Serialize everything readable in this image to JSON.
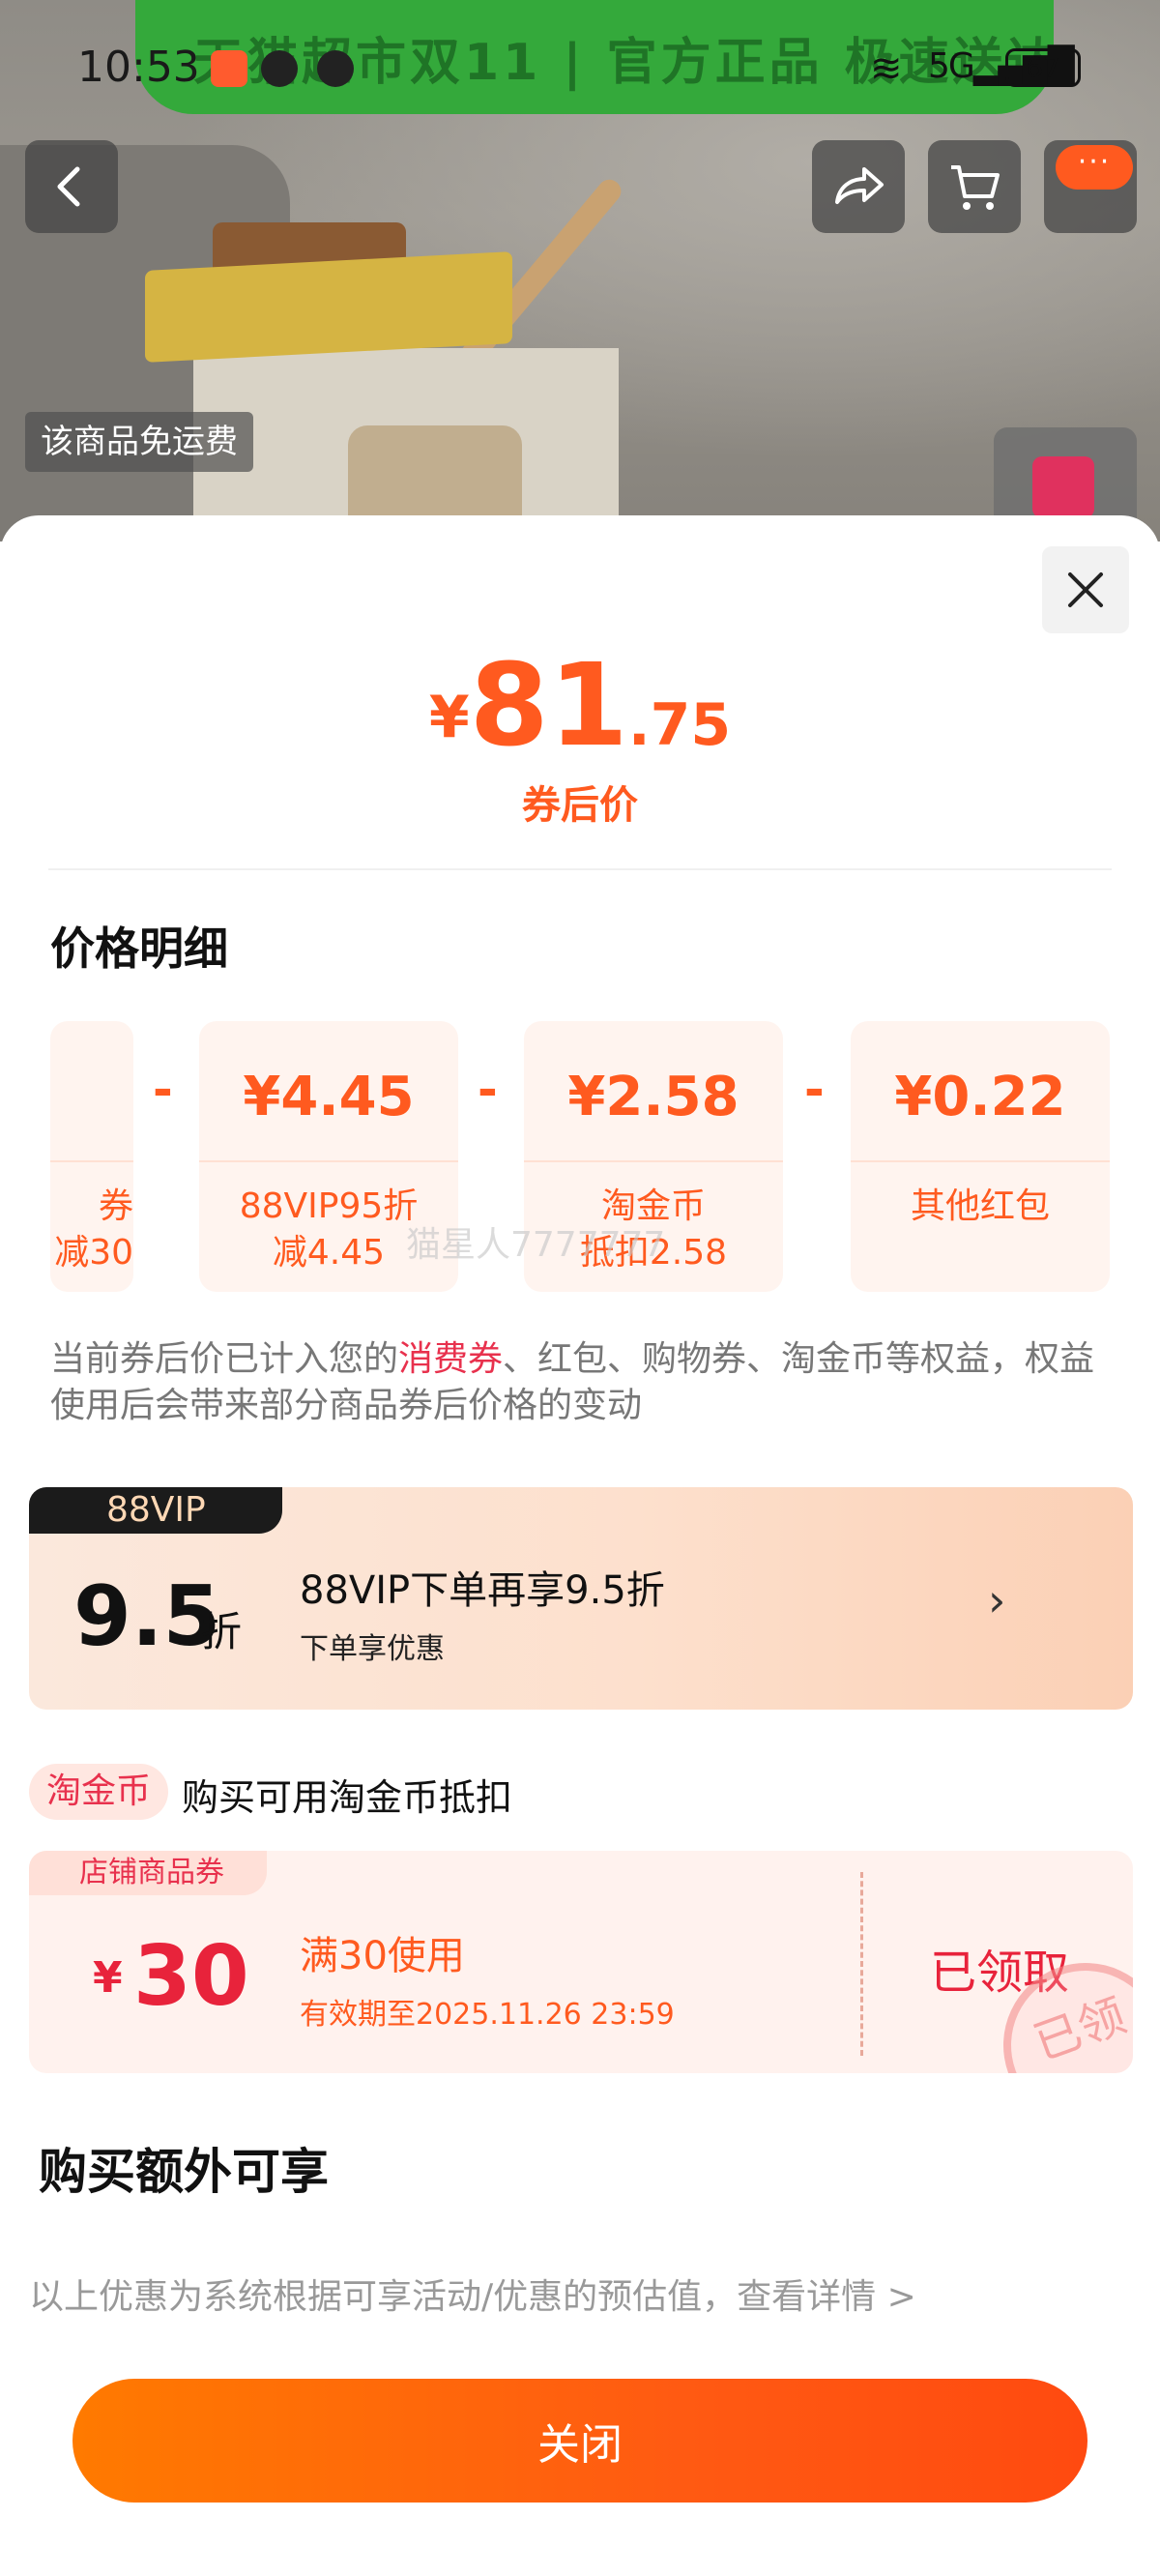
{
  "status_bar": {
    "time": "10:53",
    "signal": "5G",
    "battery": "67"
  },
  "banner": {
    "text": "天猫超市双11 | 官方正品 极速送达"
  },
  "product": {
    "free_shipping": "该商品免运费"
  },
  "sheet": {
    "price": {
      "symbol": "¥",
      "integer": "81",
      "decimal": ".75",
      "label": "券后价"
    },
    "details_title": "价格明细",
    "cards": [
      {
        "amount": "",
        "desc_line1": "券",
        "desc_line2": "减30"
      },
      {
        "amount": "¥4.45",
        "desc_line1": "88VIP95折",
        "desc_line2": "减4.45"
      },
      {
        "amount": "¥2.58",
        "desc_line1": "淘金币",
        "desc_line2": "抵扣2.58"
      },
      {
        "amount": "¥0.22",
        "desc_line1": "其他红包",
        "desc_line2": ""
      }
    ],
    "minus": "-",
    "watermark": "猫星人7777777",
    "note": {
      "before": "当前券后价已计入您的",
      "highlight": "消费券",
      "after": "、红包、购物券、淘金币等权益，权益使用后会带来部分商品券后价格的变动"
    },
    "vip": {
      "tag": "88VIP",
      "discount": "9.5",
      "unit": "折",
      "title": "88VIP下单再享9.5折",
      "subtitle": "下单享优惠",
      "arrow": "›"
    },
    "coin": {
      "tag": "淘金币",
      "text": "购买可用淘金币抵扣"
    },
    "coupon": {
      "tag": "店铺商品券",
      "symbol": "¥",
      "amount": "30",
      "condition": "满30使用",
      "expiry": "有效期至2025.11.26 23:59",
      "status": "已领取",
      "stamp": "已领"
    },
    "extra_title": "购买额外可享",
    "footnote": "以上优惠为系统根据可享活动/优惠的预估值，查看详情 >",
    "close_button": "关闭"
  },
  "colors": {
    "accent": "#ff5a1f",
    "red": "#e8233b",
    "banner_green": "#34a93b"
  }
}
